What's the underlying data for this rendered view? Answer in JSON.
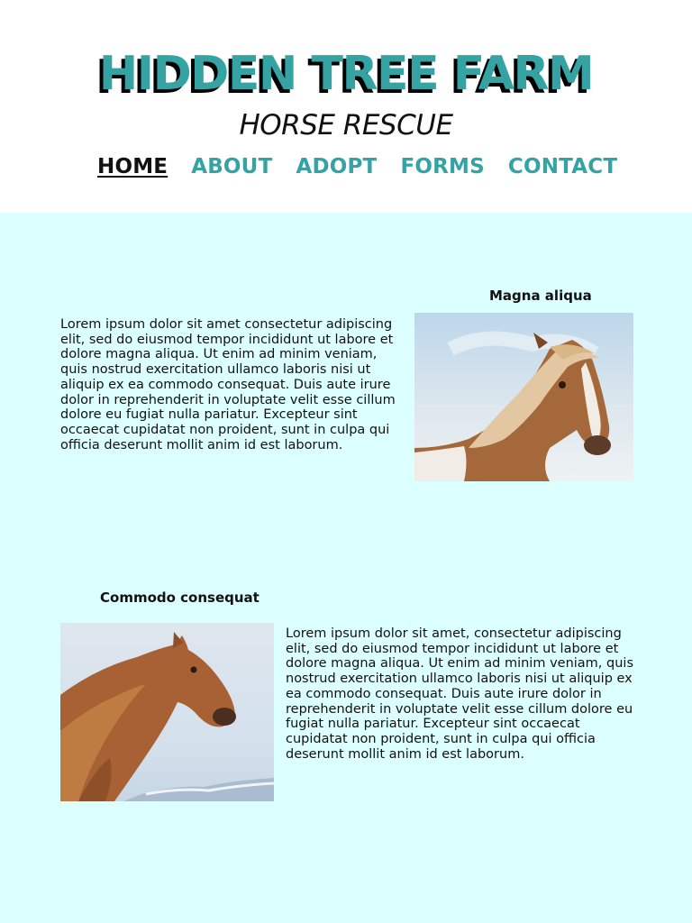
{
  "header": {
    "title": "HIDDEN TREE FARM",
    "subtitle": "HORSE RESCUE"
  },
  "nav": {
    "items": [
      {
        "label": "HOME",
        "active": true
      },
      {
        "label": "ABOUT",
        "active": false
      },
      {
        "label": "ADOPT",
        "active": false
      },
      {
        "label": "FORMS",
        "active": false
      },
      {
        "label": "CONTACT",
        "active": false
      }
    ]
  },
  "sections": [
    {
      "heading": "Magna aliqua",
      "body": "Lorem ipsum dolor sit amet consectetur adipiscing elit, sed do eiusmod tempor incididunt ut labore et dolore magna aliqua. Ut enim ad minim veniam, quis nostrud exercitation ullamco laboris nisi ut aliquip ex ea commodo consequat. Duis aute irure dolor in reprehenderit in voluptate velit esse cillum dolore eu fugiat nulla pariatur. Excepteur sint occaecat cupidatat non proident, sunt in culpa qui officia deserunt mollit anim id est laborum."
    },
    {
      "heading": "Commodo consequat",
      "body": "Lorem ipsum dolor sit amet, consectetur adipiscing elit, sed do eiusmod tempor incididunt ut labore et dolore magna aliqua. Ut enim ad minim veniam, quis nostrud exercitation ullamco laboris nisi ut aliquip ex ea commodo consequat. Duis aute irure dolor in reprehenderit in voluptate velit esse cillum dolore eu fugiat nulla pariatur. Excepteur sint occaecat cupidatat non proident, sunt in culpa qui officia deserunt mollit anim id est laborum."
    }
  ],
  "colors": {
    "accent": "#35a3a3",
    "content_background": "#dcffff",
    "text": "#111111"
  }
}
